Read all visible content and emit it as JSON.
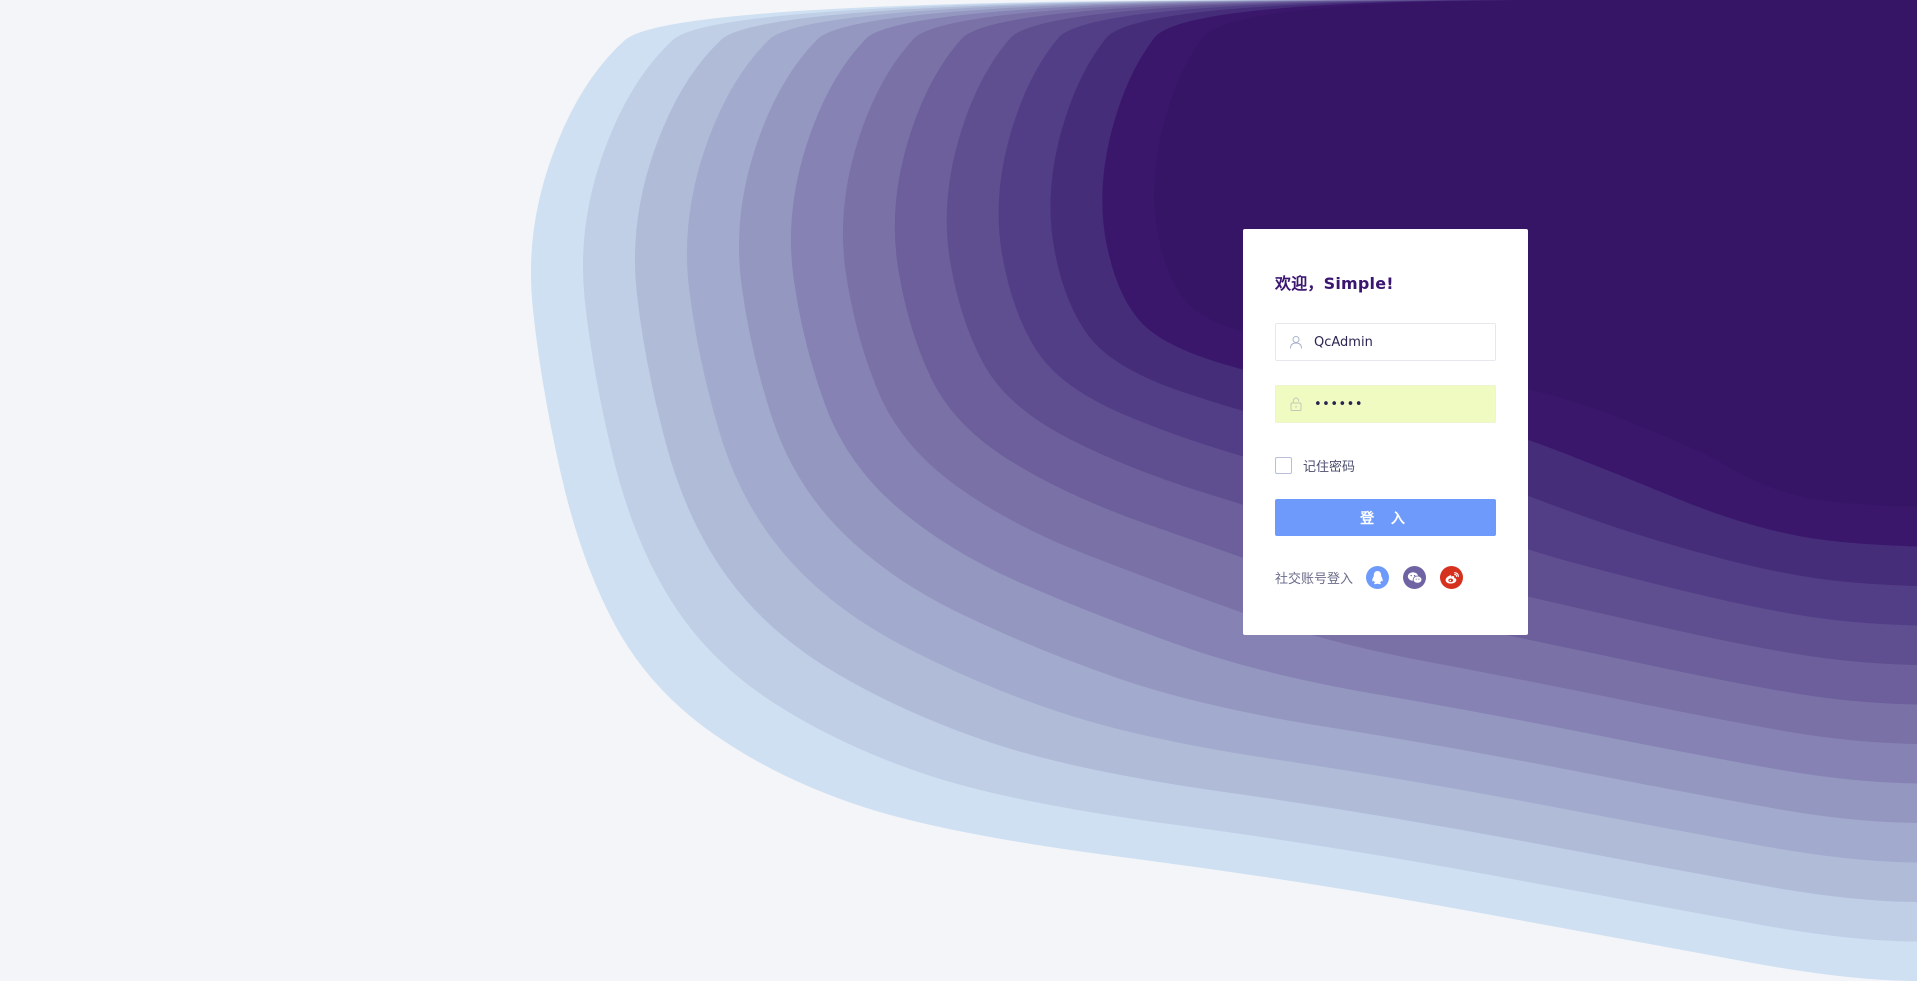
{
  "colors": {
    "background": "#f4f5f9",
    "wave_layers": [
      "#cfe0f2",
      "#c0cfe6",
      "#b0bbd8",
      "#a2aacd",
      "#9498c0",
      "#8683b4",
      "#7a72a7",
      "#6c5f9b",
      "#5f4f90",
      "#523e86",
      "#462d7a",
      "#3a176b",
      "#361566"
    ],
    "primary_button": "#6e9bfb",
    "title": "#3b1670",
    "qq": "#6e9bfb",
    "wechat": "#6f63a3",
    "weibo": "#d6301e"
  },
  "login": {
    "title": "欢迎，Simple!",
    "username": {
      "value": "QcAdmin",
      "icon": "user-icon"
    },
    "password": {
      "value": "••••••",
      "icon": "lock-icon"
    },
    "remember_label": "记住密码",
    "remember_checked": false,
    "submit_label": "登 入",
    "social": {
      "label": "社交账号登入",
      "providers": [
        {
          "name": "qq",
          "icon": "qq-icon"
        },
        {
          "name": "wechat",
          "icon": "wechat-icon"
        },
        {
          "name": "weibo",
          "icon": "weibo-icon"
        }
      ]
    }
  }
}
